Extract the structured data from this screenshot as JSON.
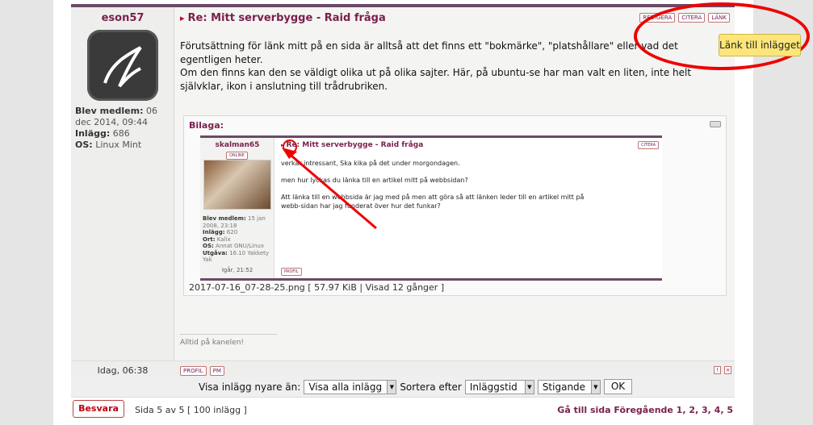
{
  "post": {
    "username": "eson57",
    "member_label": "Blev medlem:",
    "member_value": "06 dec 2014, 09:44",
    "posts_label": "Inlägg:",
    "posts_value": "686",
    "os_label": "OS:",
    "os_value": "Linux Mint",
    "title": "Re: Mitt serverbygge - Raid fråga",
    "buttons": [
      "REDIGERA",
      "CITERA",
      "LÄNK"
    ],
    "body_line1": "Förutsättning för länk mitt på en sida är alltså att det finns ett \"bokmärke\", \"platshållare\" eller vad det egentligen heter.",
    "body_line2": "Om den finns kan den se väldigt olika ut på olika sajter. Här, på ubuntu-se har man valt en liten, inte helt självklar, ikon i anslutning till trådrubriken.",
    "attachment_label": "Bilaga:",
    "attachment_file": "2017-07-16_07-28-25.png [ 57.97 KiB | Visad 12 gånger ]",
    "signature": "Alltid på kanelen!",
    "time": "Idag, 06:38",
    "footer_buttons": [
      "PROFIL",
      "PM"
    ]
  },
  "screenshot": {
    "username": "skalman65",
    "online": "ONLINE",
    "title": "Re: Mitt serverbygge - Raid fråga",
    "cite": "CITERA",
    "body1": "verkar intressant, Ska kika på det under morgondagen.",
    "body2": "men hur lyckas du länka till en artikel mitt på webbsidan?",
    "body3": "Att länka till en webbsida är jag med på men att göra så att länken leder till en artikel mitt på webb-sidan har jag funderat över hur det funkar?",
    "info_member_label": "Blev medlem:",
    "info_member": "15 jan 2008, 23:18",
    "info_posts_label": "Inlägg:",
    "info_posts": "620",
    "info_ort_label": "Ort:",
    "info_ort": "Kalix",
    "info_os_label": "OS:",
    "info_os": "Annat GNU/Linux",
    "info_utg_label": "Utgåva:",
    "info_utg": "16.10 Yakkety Yak",
    "time": "Igår, 21:52",
    "profil": "PROFIL"
  },
  "tooltip": "Länk till inlägget",
  "sortbar": {
    "label": "Visa inlägg nyare än:",
    "filter": "Visa alla inlägg",
    "sort_label": "Sortera efter",
    "sort": "Inläggstid",
    "order": "Stigande",
    "ok": "OK"
  },
  "bottom": {
    "reply": "Besvara",
    "pages": "Sida 5 av 5   [ 100 inlägg ]",
    "nav": "Gå till sida Föregående  1, 2, 3, 4, 5"
  },
  "colors": {
    "accent": "#7a1f4c",
    "annotation": "#e00000"
  }
}
